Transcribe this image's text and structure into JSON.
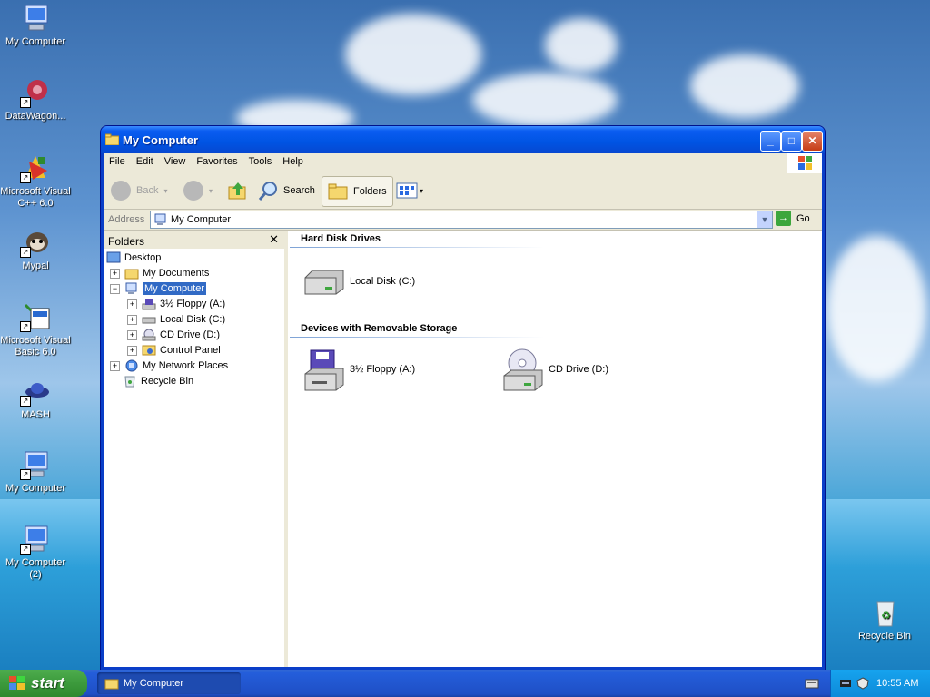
{
  "desktop": {
    "icons": [
      {
        "label": "My Computer"
      },
      {
        "label": "DataWagon..."
      },
      {
        "label": "Microsoft Visual C++ 6.0"
      },
      {
        "label": "Mypal"
      },
      {
        "label": "Microsoft Visual Basic 6.0"
      },
      {
        "label": "MASH"
      },
      {
        "label": "My Computer"
      },
      {
        "label": "My Computer (2)"
      },
      {
        "label": "Recycle Bin"
      }
    ]
  },
  "window": {
    "title": "My Computer",
    "menu": [
      "File",
      "Edit",
      "View",
      "Favorites",
      "Tools",
      "Help"
    ],
    "toolbar": {
      "back": "Back",
      "search": "Search",
      "folders": "Folders"
    },
    "address": {
      "label": "Address",
      "value": "My Computer",
      "go": "Go"
    },
    "folders_pane": {
      "title": "Folders",
      "close": "✕",
      "tree": [
        {
          "label": "Desktop"
        },
        {
          "label": "My Documents"
        },
        {
          "label": "My Computer"
        },
        {
          "label": "3½ Floppy (A:)"
        },
        {
          "label": "Local Disk (C:)"
        },
        {
          "label": "CD Drive (D:)"
        },
        {
          "label": "Control Panel"
        },
        {
          "label": "My Network Places"
        },
        {
          "label": "Recycle Bin"
        }
      ]
    },
    "content": {
      "groups": [
        {
          "title": "Hard Disk Drives",
          "items": [
            "Local Disk (C:)"
          ]
        },
        {
          "title": "Devices with Removable Storage",
          "items": [
            "3½ Floppy (A:)",
            "CD Drive (D:)"
          ]
        }
      ]
    }
  },
  "taskbar": {
    "start": "start",
    "task": "My Computer",
    "clock": "10:55 AM"
  },
  "colors": {
    "titlebar": "#0054e3",
    "selection": "#316ac5",
    "start": "#3c9a3c"
  }
}
